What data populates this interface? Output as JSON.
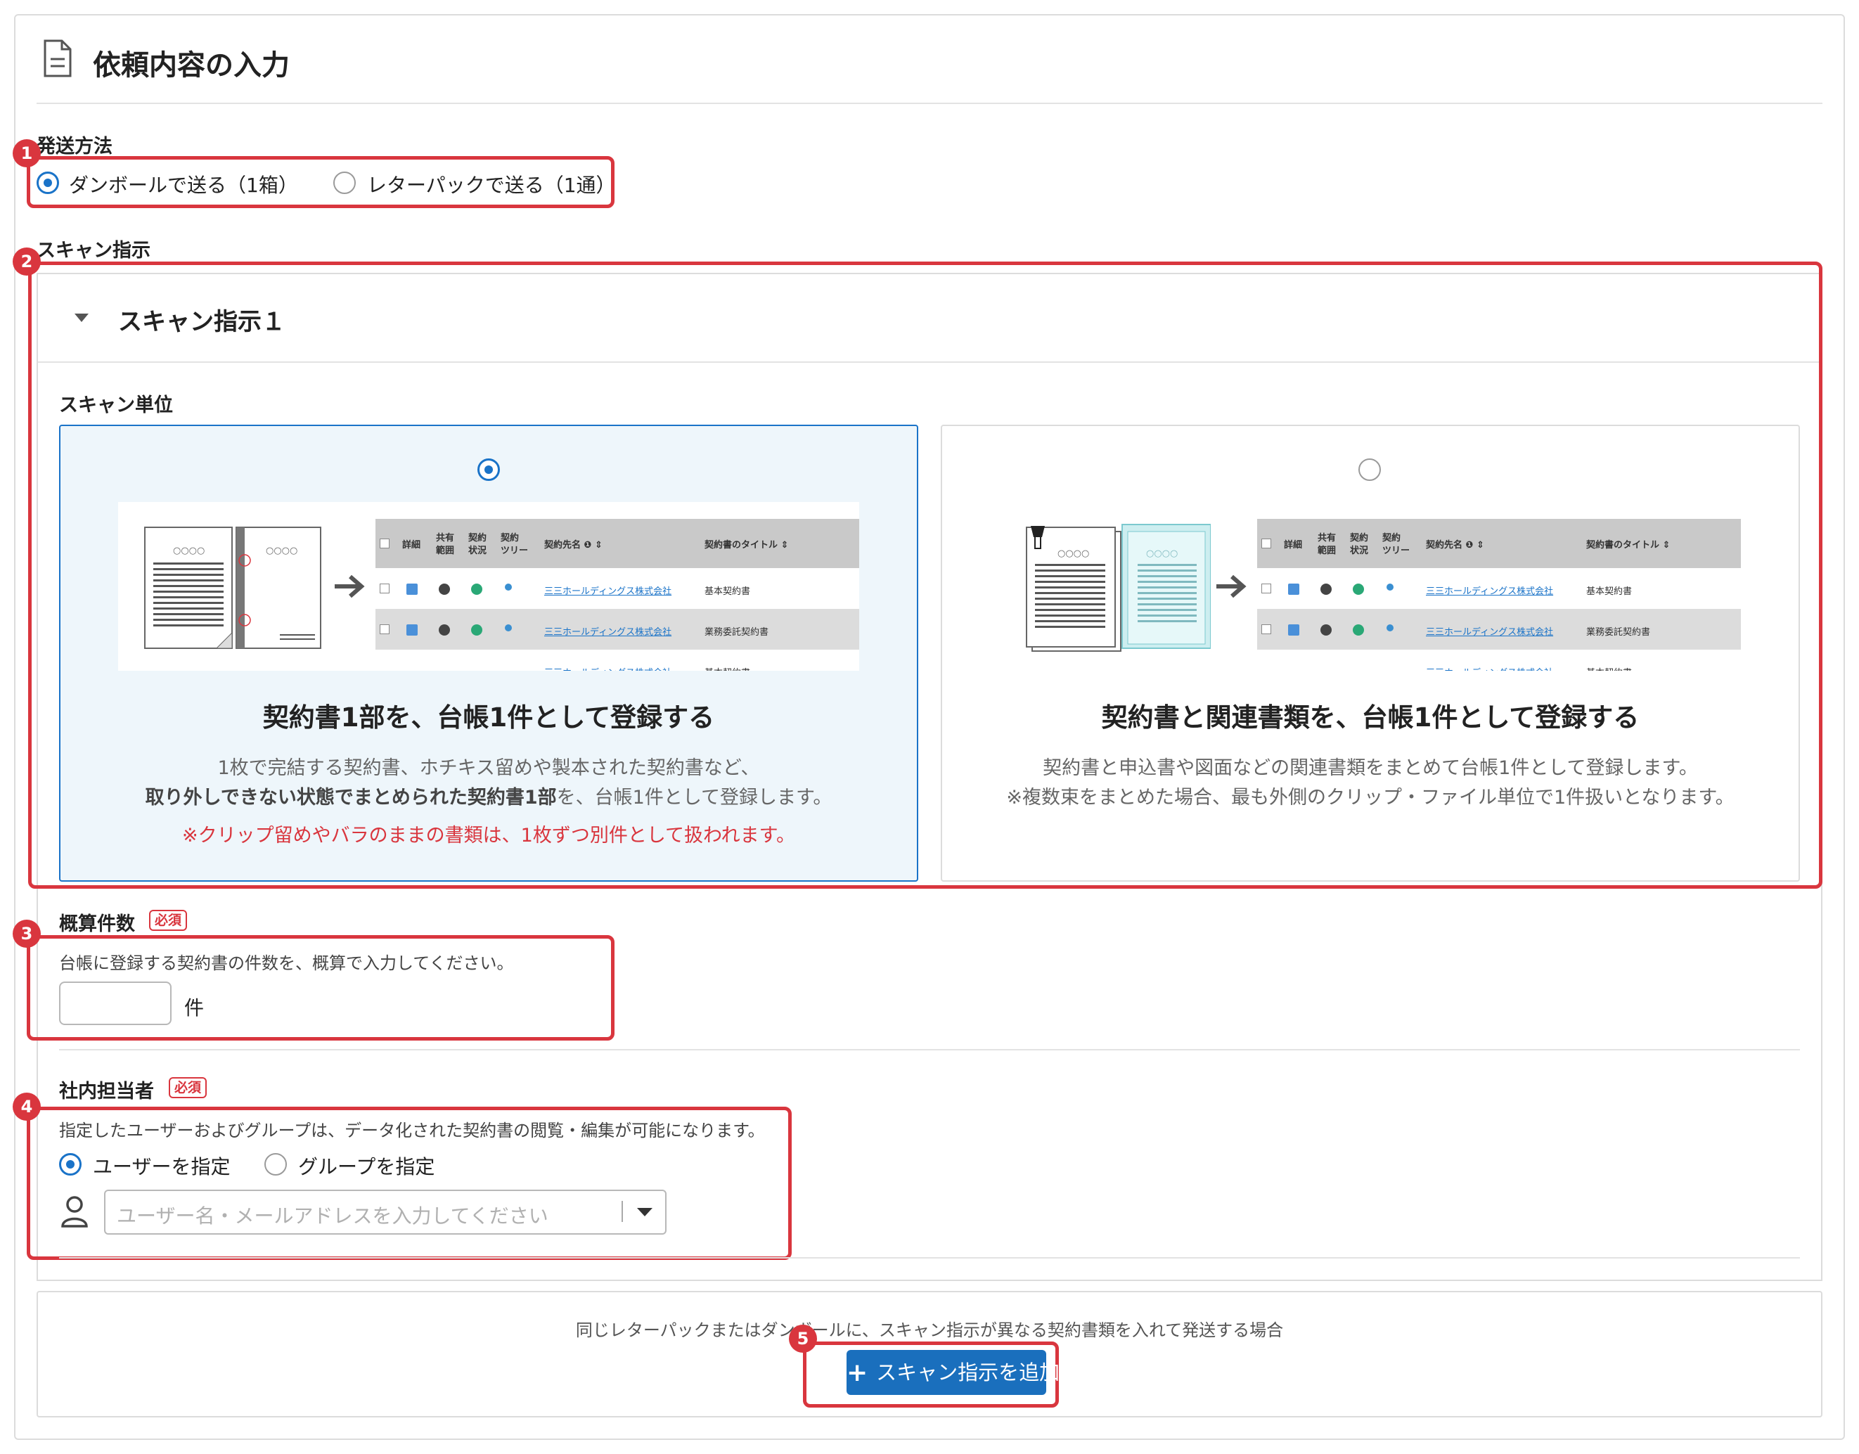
{
  "page_title": "依頼内容の入力",
  "shipping": {
    "label": "発送方法",
    "options": [
      {
        "label": "ダンボールで送る（1箱）",
        "selected": true
      },
      {
        "label": "レターパックで送る（1通）",
        "selected": false
      }
    ]
  },
  "scan": {
    "label": "スキャン指示",
    "panel_title": "スキャン指示１",
    "unit_label": "スキャン単位",
    "cards": [
      {
        "selected": true,
        "title": "契約書1部を、台帳1件として登録する",
        "desc_line1": "1枚で完結する契約書、ホチキス留めや製本された契約書など、",
        "desc_line2_bold": "取り外しできない状態でまとめられた契約書1部",
        "desc_line2_rest": "を、台帳1件として登録します。",
        "warning": "※クリップ留めやバラのままの書類は、1枚ずつ別件として扱われます。"
      },
      {
        "selected": false,
        "title": "契約書と関連書類を、台帳1件として登録する",
        "desc_line1": "契約書と申込書や図面などの関連書類をまとめて台帳1件として登録します。",
        "desc_line2": "※複数束をまとめた場合、最も外側のクリップ・ファイル単位で1件扱いとなります。"
      }
    ],
    "illustration": {
      "doc_text": "○○○○",
      "table_headers": {
        "detail": "詳細",
        "share_1": "共有",
        "share_2": "範囲",
        "status_1": "契約",
        "status_2": "状況",
        "tree_1": "契約",
        "tree_2": "ツリー",
        "party": "契約先名 ❶ ⇕",
        "doc_title": "契約書のタイトル ⇕"
      },
      "rows": [
        {
          "party": "三三ホールディングス株式会社",
          "title": "基本契約書"
        },
        {
          "party": "三三ホールディングス株式会社",
          "title": "業務委託契約書"
        },
        {
          "party": "三三ホールディングス株式会社",
          "title": "基本契約書"
        }
      ]
    }
  },
  "estimate": {
    "label": "概算件数",
    "required": "必須",
    "help": "台帳に登録する契約書の件数を、概算で入力してください。",
    "value": "",
    "unit": "件"
  },
  "owner": {
    "label": "社内担当者",
    "required": "必須",
    "help": "指定したユーザーおよびグループは、データ化された契約書の閲覧・編集が可能になります。",
    "options": [
      {
        "label": "ユーザーを指定",
        "selected": true
      },
      {
        "label": "グループを指定",
        "selected": false
      }
    ],
    "placeholder": "ユーザー名・メールアドレスを入力してください"
  },
  "footer": {
    "note": "同じレターパックまたはダンボールに、スキャン指示が異なる契約書類を入れて発送する場合",
    "add_button": "スキャン指示を追加"
  },
  "callouts": [
    "1",
    "2",
    "3",
    "4",
    "5"
  ],
  "colors": {
    "accent": "#1a73c8",
    "callout": "#d9363e",
    "selected_bg": "#eef6fb"
  }
}
